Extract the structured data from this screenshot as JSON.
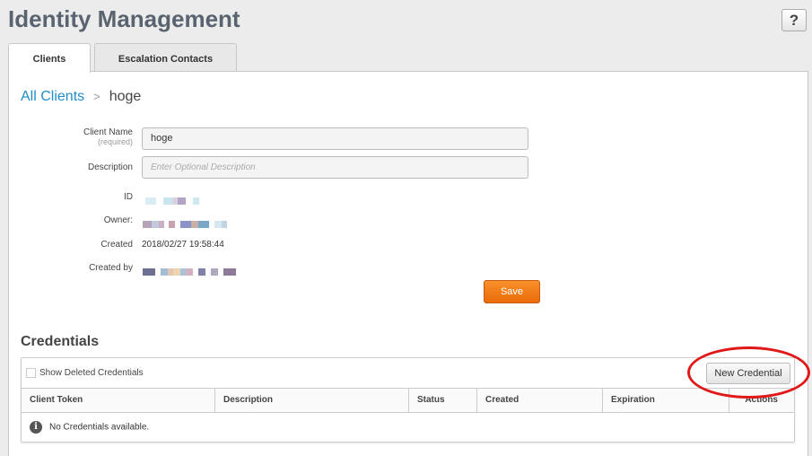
{
  "header": {
    "title": "Identity Management",
    "help_label": "?"
  },
  "tabs": [
    {
      "label": "Clients"
    },
    {
      "label": "Escalation Contacts"
    }
  ],
  "breadcrumb": {
    "root": "All Clients",
    "separator": ">",
    "current": "hoge"
  },
  "form": {
    "client_name_label": "Client Name",
    "client_name_required": "(required)",
    "client_name_value": "hoge",
    "description_label": "Description",
    "description_placeholder": "Enter Optional Description",
    "id_label": "ID",
    "owner_label": "Owner:",
    "created_label": "Created",
    "created_value": "2018/02/27 19:58:44",
    "created_by_label": "Created by",
    "save_label": "Save"
  },
  "credentials": {
    "title": "Credentials",
    "show_deleted_label": "Show Deleted Credentials",
    "new_credential_label": "New Credential",
    "columns": [
      "Client Token",
      "Description",
      "Status",
      "Created",
      "Expiration",
      "Actions"
    ],
    "empty_message": "No Credentials available."
  },
  "colors": {
    "accent": "#1f8dc6",
    "save": "#f07d1a",
    "annotation": "#e01818"
  }
}
